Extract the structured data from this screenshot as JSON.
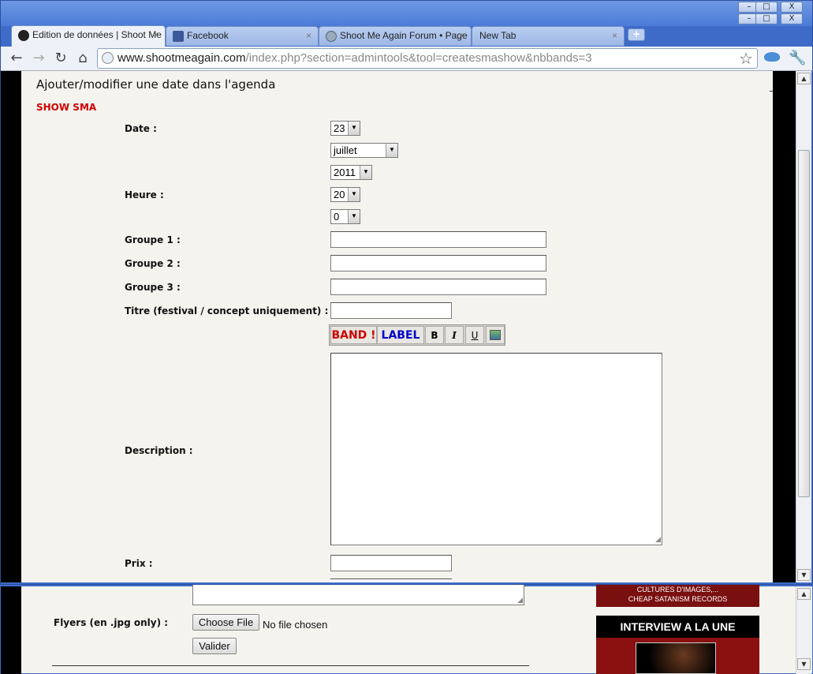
{
  "browser": {
    "tabs": [
      {
        "label": "Edition de données | Shoot Me",
        "active": true
      },
      {
        "label": "Facebook",
        "active": false
      },
      {
        "label": "Shoot Me Again Forum • Page",
        "active": false
      },
      {
        "label": "New Tab",
        "active": false
      }
    ],
    "new_tab_label": "+",
    "url_host": "www.shootmeagain.com",
    "url_path": "/index.php?section=admintools&tool=createsmashow&nbbands=3",
    "window_controls": [
      "–",
      "□",
      "X"
    ]
  },
  "page": {
    "title": "Ajouter/modifier une date dans l'agenda",
    "subtitle": "SHOW SMA",
    "form": {
      "date_label": "Date :",
      "day_value": "23",
      "month_value": "juillet",
      "year_value": "2011",
      "hour_label": "Heure :",
      "hour_value": "20",
      "minute_value": "0",
      "group1_label": "Groupe 1 :",
      "group2_label": "Groupe 2 :",
      "group3_label": "Groupe 3 :",
      "title_label": "Titre (festival / concept uniquement) :",
      "editor_buttons": {
        "band": "BAND !",
        "label": "LABEL",
        "bold": "B",
        "italic": "I",
        "underline": "U"
      },
      "description_label": "Description :",
      "price_label": "Prix :"
    }
  },
  "background_window": {
    "flyers_label": "Flyers (en .jpg only) :",
    "choose_file_button": "Choose File",
    "no_file_text": "No file chosen",
    "submit_button": "Valider",
    "promo_text_line1": "CULTURES D'IMAGES,...",
    "promo_text_line2": "CHEAP SATANISM RECORDS",
    "promo_heading": "INTERVIEW A LA UNE"
  },
  "colors": {
    "accent_red": "#d00000",
    "label_blue": "#0000cc",
    "band_red": "#cc0000"
  }
}
